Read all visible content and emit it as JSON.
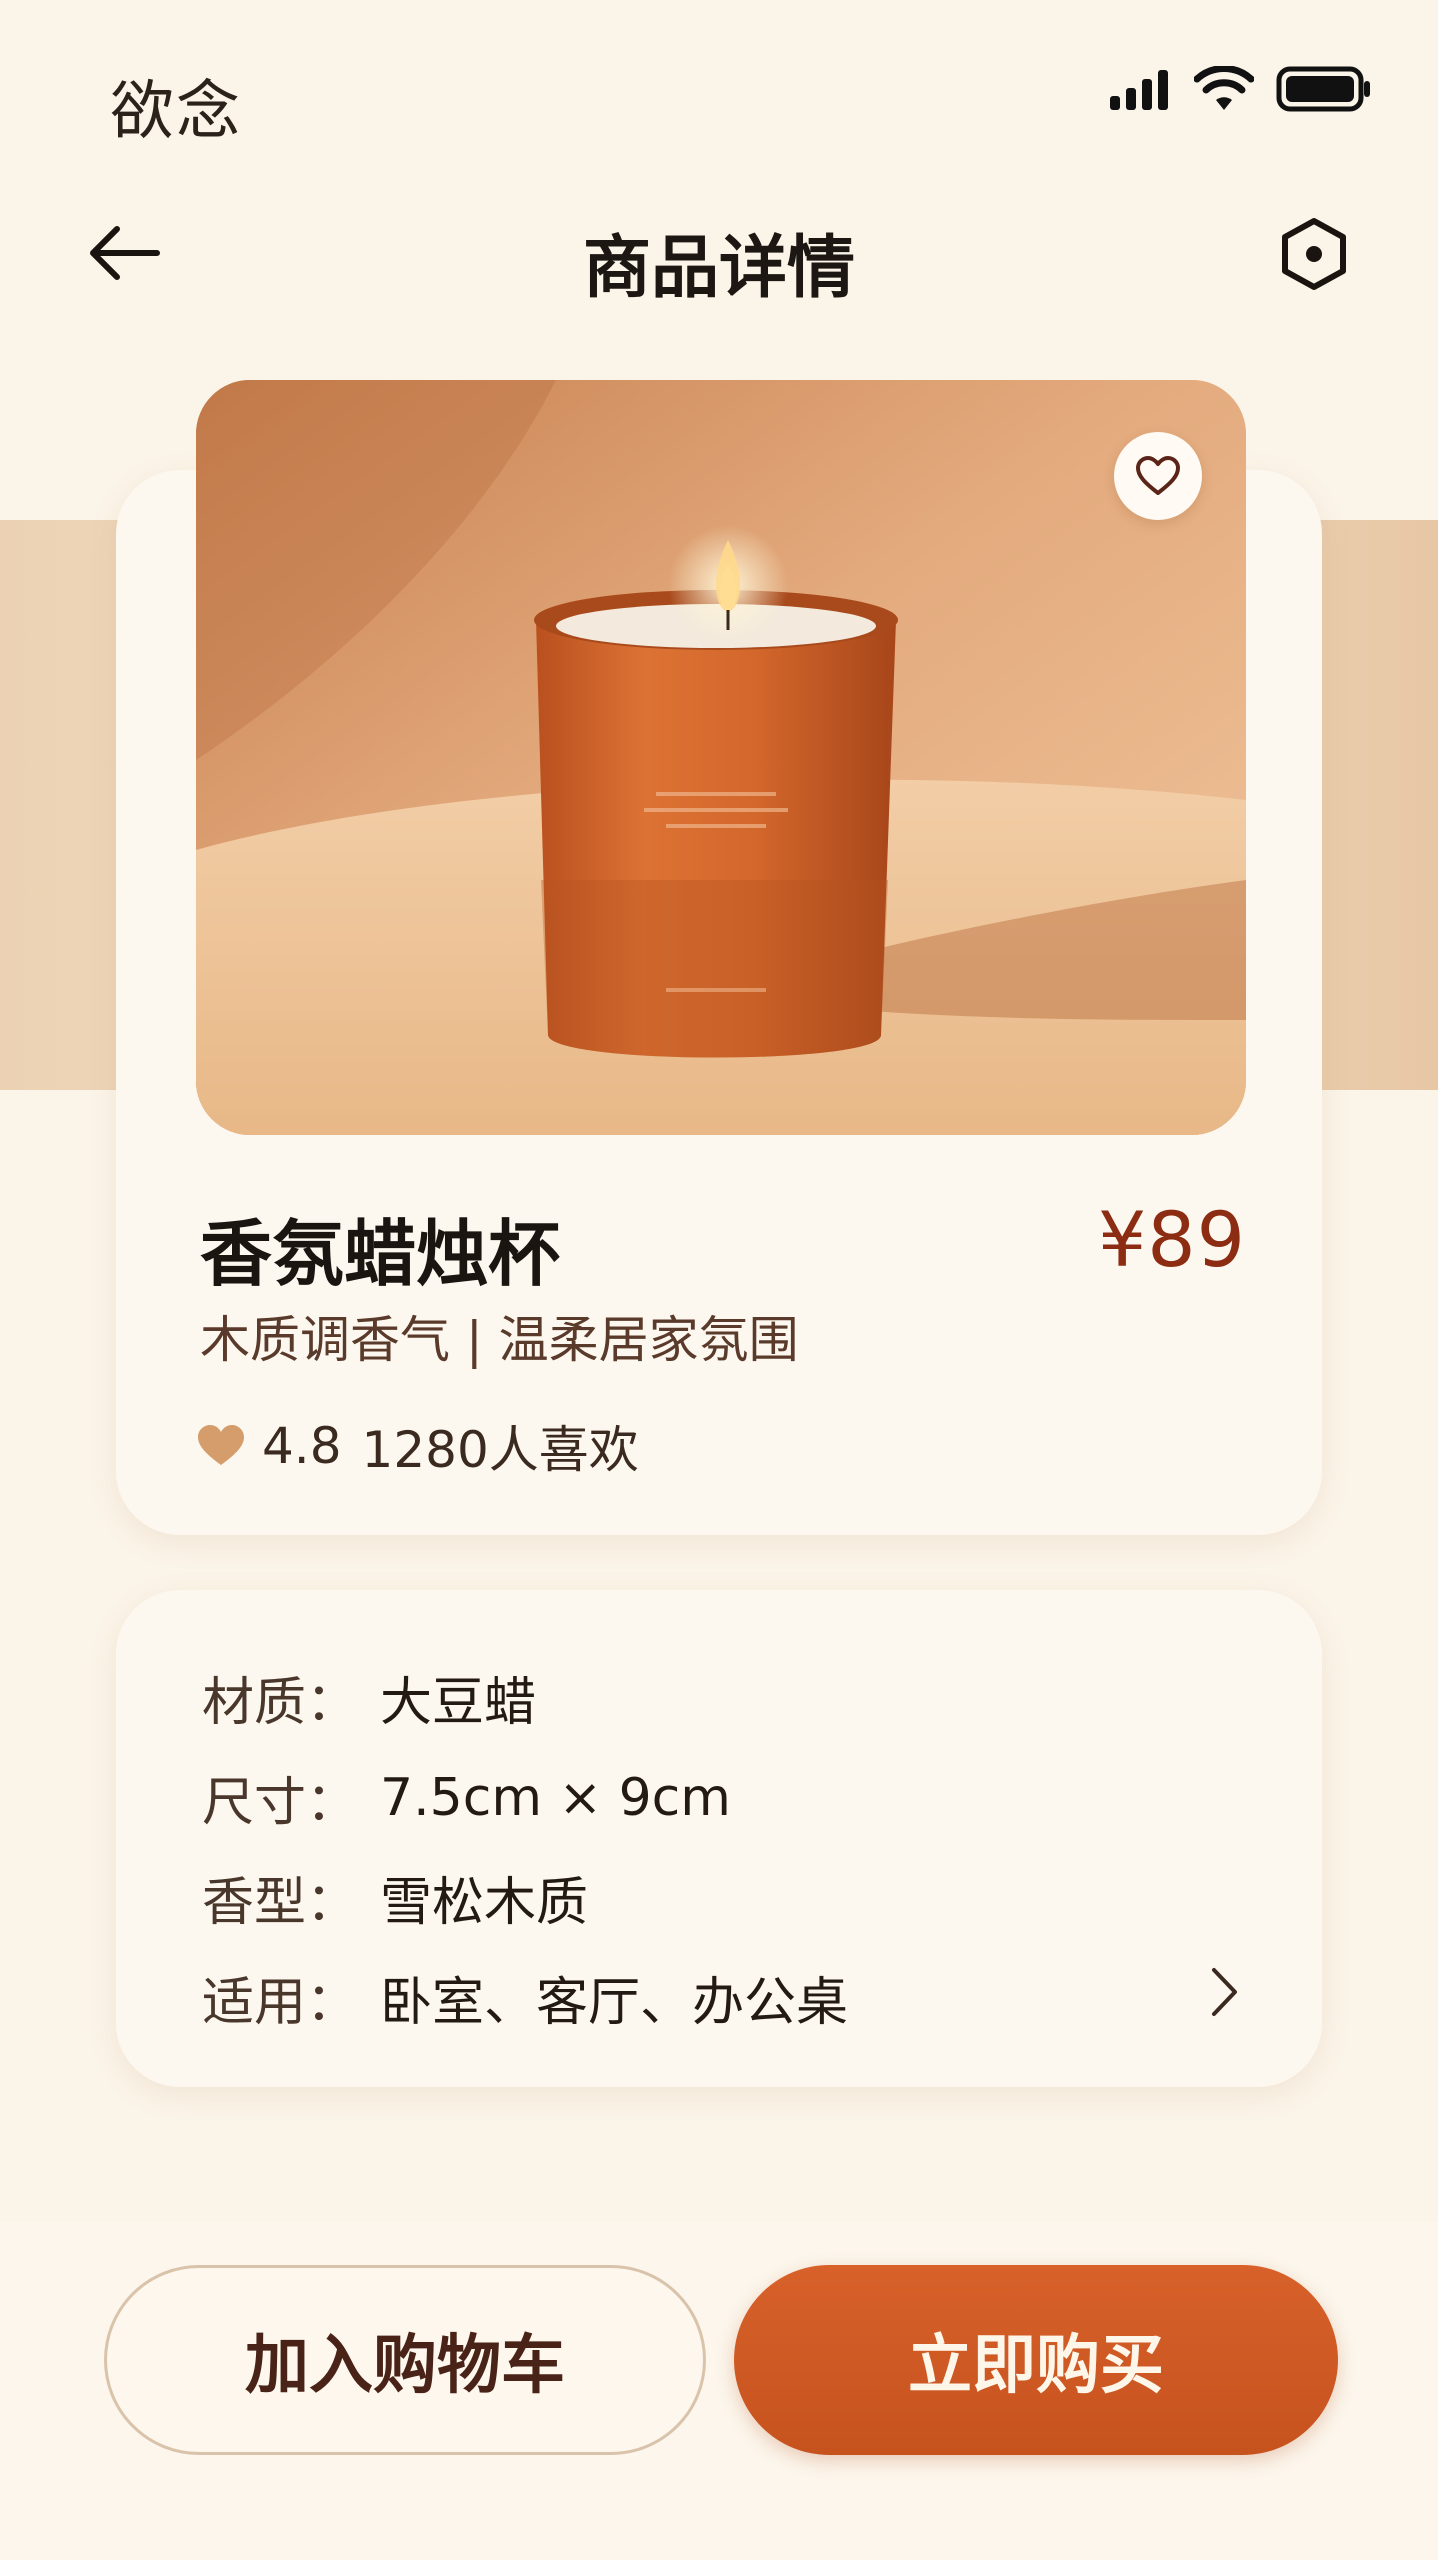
{
  "status_bar": {
    "brand": "欲念",
    "icons": [
      "signal-icon",
      "wifi-icon",
      "battery-icon"
    ]
  },
  "nav": {
    "title": "商品详情",
    "back_icon": "arrow-left-icon",
    "more_icon": "hexagon-dot-icon"
  },
  "product": {
    "name": "香氛蜡烛杯",
    "price": "¥89",
    "subtitle": "木质调香气 | 温柔居家氛围",
    "rating": "4.8",
    "likes": "1280人喜欢",
    "favorite_icon": "heart-outline-icon",
    "rating_icon": "heart-filled-icon",
    "image": "orange candle cup photo"
  },
  "specs": [
    {
      "label": "材质",
      "value": "大豆蜡"
    },
    {
      "label": "尺寸",
      "value": "7.5cm × 9cm"
    },
    {
      "label": "香型",
      "value": "雪松木质"
    },
    {
      "label": "适用",
      "value": "卧室、客厅、办公桌"
    }
  ],
  "actions": {
    "add_to_cart": "加入购物车",
    "buy_now": "立即购买"
  },
  "colors": {
    "background": "#fbf4e8",
    "accent": "#c9531f",
    "price": "#8c2c12",
    "card": "#fdf8ef"
  }
}
